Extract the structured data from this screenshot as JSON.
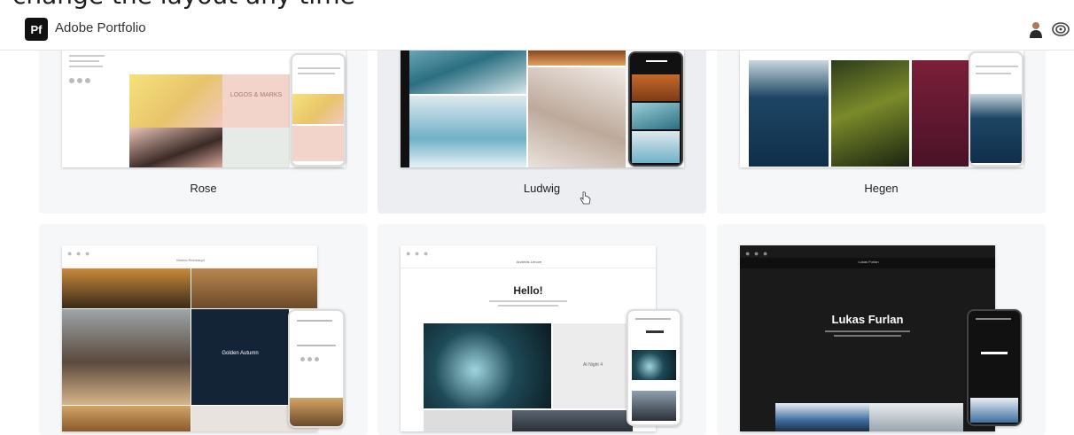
{
  "overlay": {
    "caption": "change the layout any time"
  },
  "header": {
    "logo_text": "Pf",
    "brand": "Adobe Portfolio",
    "avatar_icon": "user-avatar-icon",
    "cc_icon": "creative-cloud-icon"
  },
  "themes": [
    {
      "name": "Rose"
    },
    {
      "name": "Ludwig"
    },
    {
      "name": "Hegen"
    },
    {
      "name": "Marina Reinhaupt"
    },
    {
      "name": "Andreas Lenore",
      "hero": "Hello!"
    },
    {
      "name": "Lukas Furlan",
      "hero": "Lukas Furlan"
    }
  ],
  "rose_preview": {
    "logos": "LOGOS & MARKS"
  },
  "marina_preview": {
    "feature": "Golden Autumn"
  },
  "andreas_preview": {
    "side": "At Night 4"
  },
  "colors": {
    "card_bg": "#f6f7f9",
    "card_hover_bg": "#eceef1",
    "accent": "#111111"
  }
}
